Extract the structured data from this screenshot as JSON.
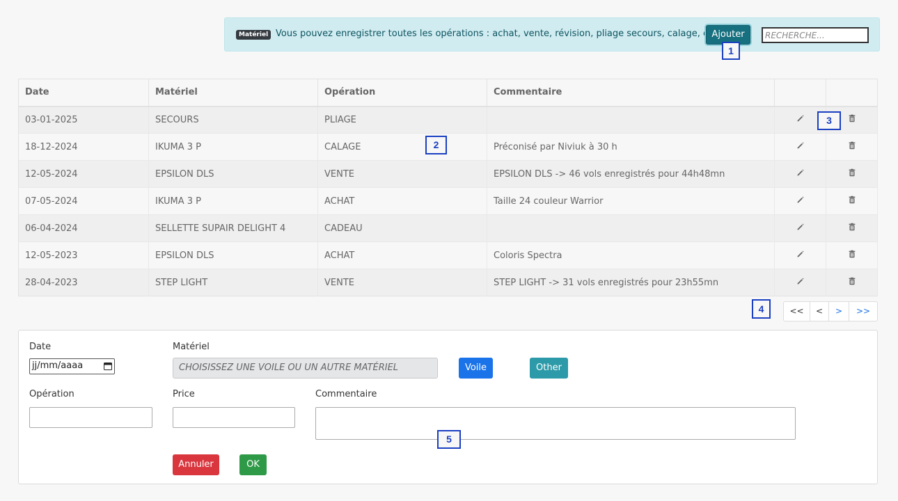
{
  "banner": {
    "badge": "Matériel",
    "text": "Vous pouvez enregistrer toutes les opérations : achat, vente, révision, pliage secours, calage, etc...",
    "add_label": "Ajouter",
    "search_placeholder": "RECHERCHE..."
  },
  "markers": {
    "m1": "1",
    "m2": "2",
    "m3": "3",
    "m4": "4",
    "m5": "5"
  },
  "table": {
    "headers": {
      "date": "Date",
      "materiel": "Matériel",
      "operation": "Opération",
      "commentaire": "Commentaire"
    },
    "rows": [
      {
        "date": "03-01-2025",
        "materiel": "SECOURS",
        "operation": "PLIAGE",
        "commentaire": ""
      },
      {
        "date": "18-12-2024",
        "materiel": "IKUMA 3 P",
        "operation": "CALAGE",
        "commentaire": "Préconisé par Niviuk à 30 h"
      },
      {
        "date": "12-05-2024",
        "materiel": "EPSILON DLS",
        "operation": "VENTE",
        "commentaire": "EPSILON DLS -> 46 vols enregistrés pour 44h48mn"
      },
      {
        "date": "07-05-2024",
        "materiel": "IKUMA 3 P",
        "operation": "ACHAT",
        "commentaire": "Taille 24 couleur Warrior"
      },
      {
        "date": "06-04-2024",
        "materiel": "SELLETTE SUPAIR DELIGHT 4",
        "operation": "CADEAU",
        "commentaire": ""
      },
      {
        "date": "12-05-2023",
        "materiel": "EPSILON DLS",
        "operation": "ACHAT",
        "commentaire": "Coloris Spectra"
      },
      {
        "date": "28-04-2023",
        "materiel": "STEP LIGHT",
        "operation": "VENTE",
        "commentaire": "STEP LIGHT -> 31 vols enregistrés pour 23h55mn"
      }
    ]
  },
  "pager": {
    "first": "<<",
    "prev": "<",
    "next": ">",
    "last": ">>"
  },
  "form": {
    "date_label": "Date",
    "date_value": "jj/mm/aaaa",
    "materiel_label": "Matériel",
    "materiel_placeholder": "CHOISISSEZ UNE VOILE OU UN AUTRE MATÉRIEL",
    "voile_label": "Voile",
    "other_label": "Other",
    "operation_label": "Opération",
    "price_label": "Price",
    "commentaire_label": "Commentaire",
    "cancel_label": "Annuler",
    "ok_label": "OK"
  },
  "colors": {
    "info_bg": "#d1ecf1",
    "add_button": "#17707f",
    "voile_button": "#1a73e8",
    "other_button": "#2c9aa8",
    "cancel_button": "#d9363e",
    "ok_button": "#2e9a47",
    "marker": "#1a3fc2"
  },
  "icons": {
    "edit": "pencil-icon",
    "delete": "trash-icon",
    "calendar": "calendar-icon"
  }
}
